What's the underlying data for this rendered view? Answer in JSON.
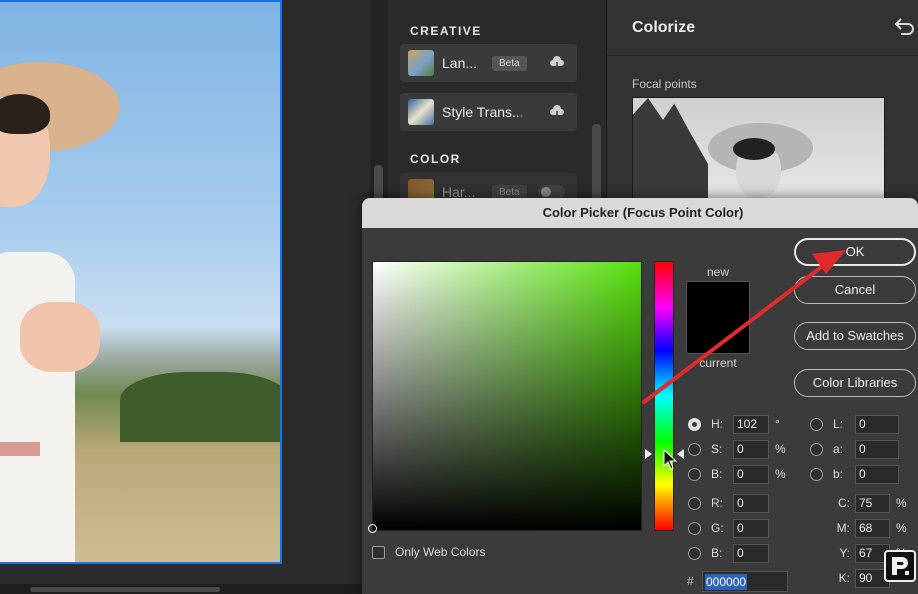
{
  "colors": {
    "accent": "#1a73e8",
    "annotation_arrow": "#e12b2b",
    "hue_selected": "#55e00a"
  },
  "filters_panel": {
    "sections": [
      {
        "title": "CREATIVE",
        "items": [
          {
            "label": "Lan...",
            "badge": "Beta",
            "icon": "cloud-download-icon"
          },
          {
            "label": "Style Trans...",
            "icon": "cloud-download-icon"
          }
        ]
      },
      {
        "title": "COLOR",
        "items": [
          {
            "label": "Har...",
            "badge": "Beta",
            "icon": "toggle-switch"
          }
        ]
      }
    ]
  },
  "right_panel": {
    "title": "Colorize",
    "undo_icon": "undo-icon",
    "focal_points_label": "Focal points"
  },
  "color_picker": {
    "title": "Color Picker (Focus Point Color)",
    "new_label": "new",
    "current_label": "current",
    "buttons": {
      "ok": "OK",
      "cancel": "Cancel",
      "add_to_swatches": "Add to Swatches",
      "color_libraries": "Color Libraries"
    },
    "hsb": [
      {
        "label": "H:",
        "value": "102",
        "unit": "°",
        "selected": true
      },
      {
        "label": "S:",
        "value": "0",
        "unit": "%",
        "selected": false
      },
      {
        "label": "B:",
        "value": "0",
        "unit": "%",
        "selected": false
      }
    ],
    "rgb": [
      {
        "label": "R:",
        "value": "0"
      },
      {
        "label": "G:",
        "value": "0"
      },
      {
        "label": "B:",
        "value": "0"
      }
    ],
    "lab": [
      {
        "label": "L:",
        "value": "0"
      },
      {
        "label": "a:",
        "value": "0"
      },
      {
        "label": "b:",
        "value": "0"
      }
    ],
    "cmyk": [
      {
        "label": "C:",
        "value": "75",
        "unit": "%"
      },
      {
        "label": "M:",
        "value": "68",
        "unit": "%"
      },
      {
        "label": "Y:",
        "value": "67",
        "unit": "%"
      },
      {
        "label": "K:",
        "value": "90",
        "unit": ""
      }
    ],
    "hex_prefix": "#",
    "hex_value": "000000",
    "only_web_colors_label": "Only Web Colors"
  }
}
